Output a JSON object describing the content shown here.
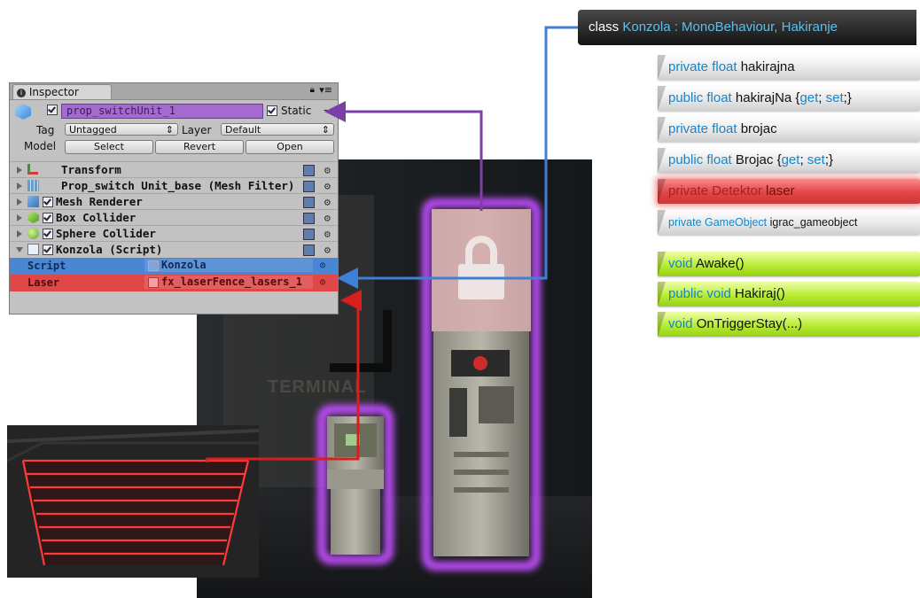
{
  "inspector": {
    "tab_label": "Inspector",
    "object_name": "prop_switchUnit_1",
    "static_label": "Static",
    "tag_label": "Tag",
    "tag_value": "Untagged",
    "layer_label": "Layer",
    "layer_value": "Default",
    "model_label": "Model",
    "model_buttons": [
      "Select",
      "Revert",
      "Open"
    ],
    "components": [
      {
        "name": "Transform",
        "has_checkbox": false,
        "icon": "transform-icon"
      },
      {
        "name": "Prop_switch Unit_base (Mesh Filter)",
        "has_checkbox": false,
        "icon": "mesh-filter-icon"
      },
      {
        "name": "Mesh Renderer",
        "has_checkbox": true,
        "icon": "mesh-renderer-icon"
      },
      {
        "name": "Box Collider",
        "has_checkbox": true,
        "icon": "box-collider-icon"
      },
      {
        "name": "Sphere Collider",
        "has_checkbox": true,
        "icon": "sphere-collider-icon"
      },
      {
        "name": "Konzola (Script)",
        "has_checkbox": true,
        "icon": "script-icon"
      }
    ],
    "fields": [
      {
        "label": "Script",
        "value": "Konzola",
        "highlight": "#3f7fd6"
      },
      {
        "label": "Laser",
        "value": "fx_laserFence_lasers_1",
        "highlight": "#d93b3b"
      }
    ]
  },
  "scene": {
    "sign_text": "TERMINAL"
  },
  "code": {
    "class_header": {
      "prefix": "class ",
      "rest": "Konzola : MonoBehaviour, Hakiranje"
    },
    "members": [
      {
        "kw": "private float",
        "rest": " hakirajna",
        "style": "white"
      },
      {
        "kw": "public float",
        "rest": " hakirajNa {",
        "kw2": "get",
        "rest2": "; ",
        "kw3": "set",
        "rest3": ";}",
        "style": "white"
      },
      {
        "kw": "private float",
        "rest": " brojac",
        "style": "white"
      },
      {
        "kw": "public float",
        "rest": " Brojac {",
        "kw2": "get",
        "rest2": "; ",
        "kw3": "set",
        "rest3": ";}",
        "style": "white"
      },
      {
        "kw": "private Detektor",
        "rest": " laser",
        "style": "red"
      },
      {
        "kw": "private GameObject",
        "rest": " igrac_gameobject",
        "style": "white-small"
      }
    ],
    "methods": [
      {
        "kw": "void",
        "rest": " Awake()"
      },
      {
        "kw": "public void",
        "rest": " Hakiraj()"
      },
      {
        "kw": "void",
        "rest": " OnTriggerStay(...)"
      }
    ]
  },
  "colors": {
    "purple": "#7b3fa8",
    "blue": "#3f7fd6",
    "red": "#d91e1e",
    "keyword": "#1b84c4",
    "glow": "#c24dff"
  }
}
